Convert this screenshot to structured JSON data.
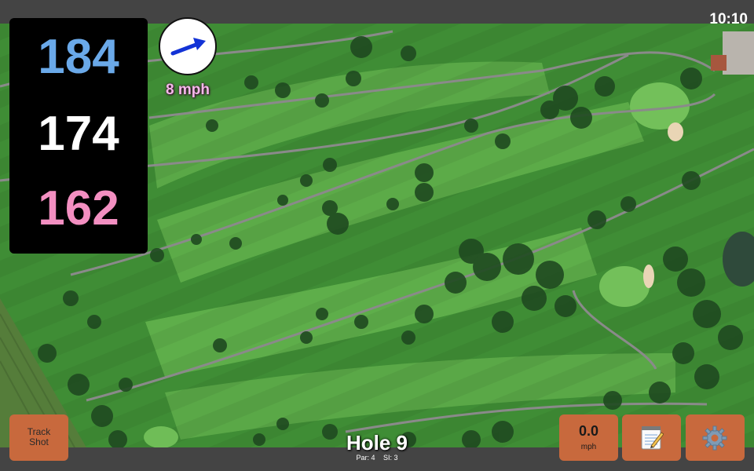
{
  "status_bar": {
    "time": "10:10"
  },
  "distances": {
    "back": "184",
    "middle": "174",
    "front": "162"
  },
  "wind": {
    "speed": "8 mph",
    "direction_icon": "wind-arrow-icon"
  },
  "hole": {
    "title": "Hole 9",
    "par_label": "Par: 4",
    "si_label": "SI: 3"
  },
  "buttons": {
    "track_shot": {
      "line1": "Track",
      "line2": "Shot"
    },
    "speed": {
      "value": "0.0",
      "unit": "mph"
    },
    "notes": {
      "icon": "notepad-icon"
    },
    "settings": {
      "icon": "gear-icon"
    }
  },
  "colors": {
    "back_distance": "#6aa9e9",
    "middle_distance": "#ffffff",
    "front_distance": "#f38fc1",
    "button": "#c8693d",
    "bar": "#444444"
  }
}
